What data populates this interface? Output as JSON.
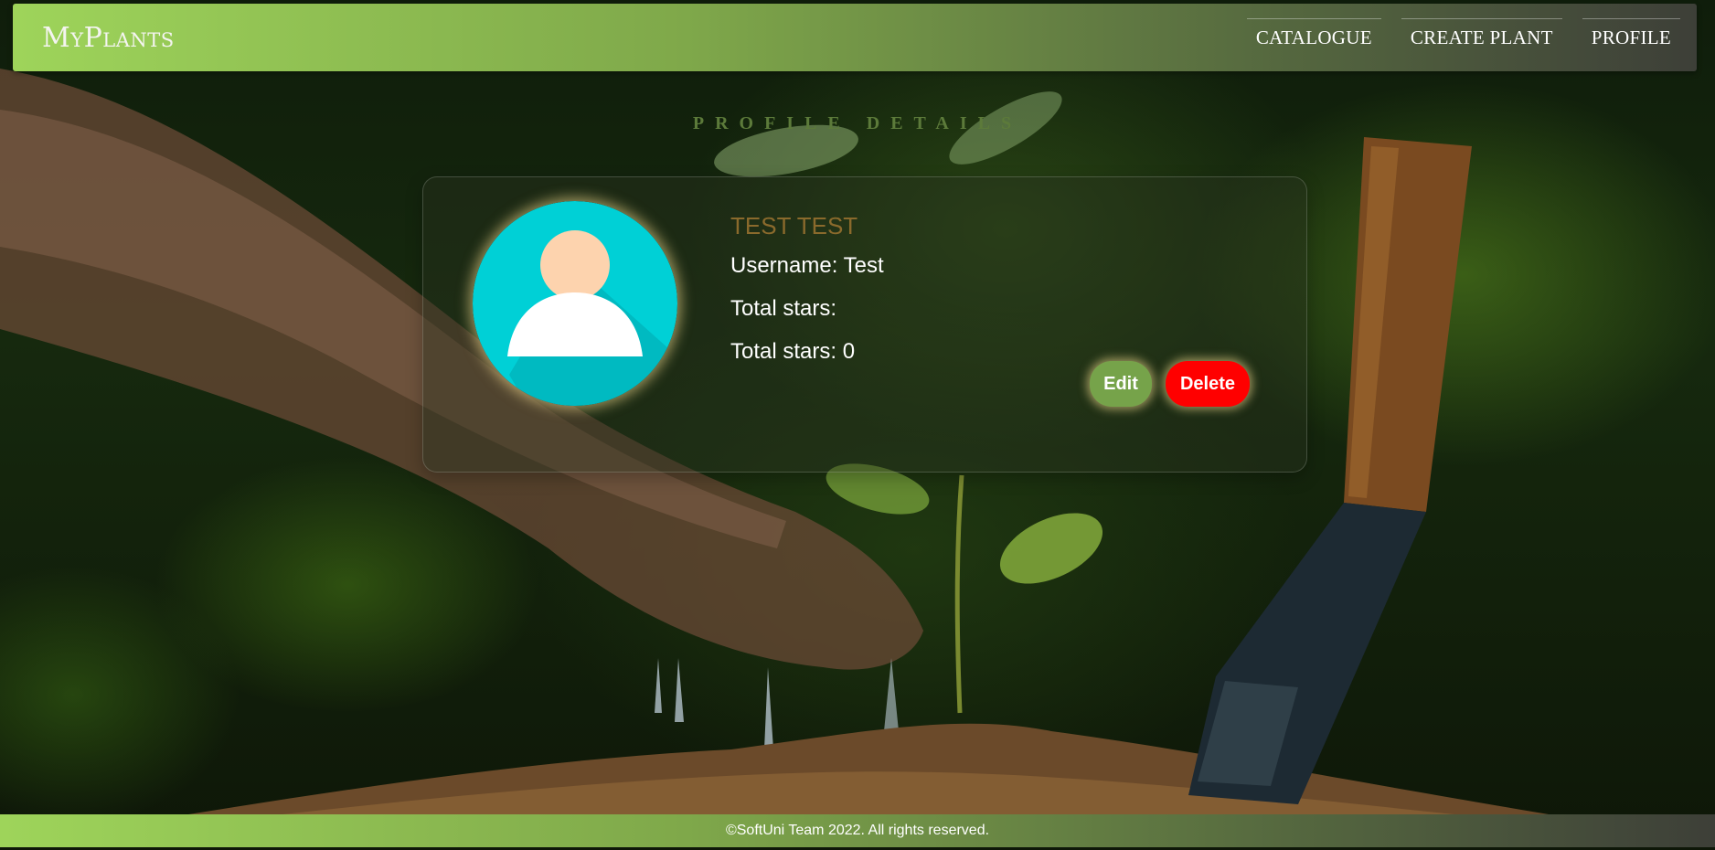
{
  "header": {
    "logo": "MyPlants",
    "nav": [
      {
        "label": "CATALOGUE"
      },
      {
        "label": "CREATE PLANT"
      },
      {
        "label": "PROFILE"
      }
    ]
  },
  "profile": {
    "section_title": "PROFILE DETAILS",
    "full_name": "TEST TEST",
    "username_line": "Username: Test",
    "total_stars_label": "Total stars:",
    "total_stars_line": "Total stars: 0",
    "edit_label": "Edit",
    "delete_label": "Delete"
  },
  "footer": {
    "text": "©SoftUni Team 2022. All rights reserved."
  },
  "colors": {
    "accent_green": "#9ed45a",
    "edit_button": "#76a34a",
    "delete_button": "#ff0000",
    "avatar_bg": "#00d0d6"
  }
}
